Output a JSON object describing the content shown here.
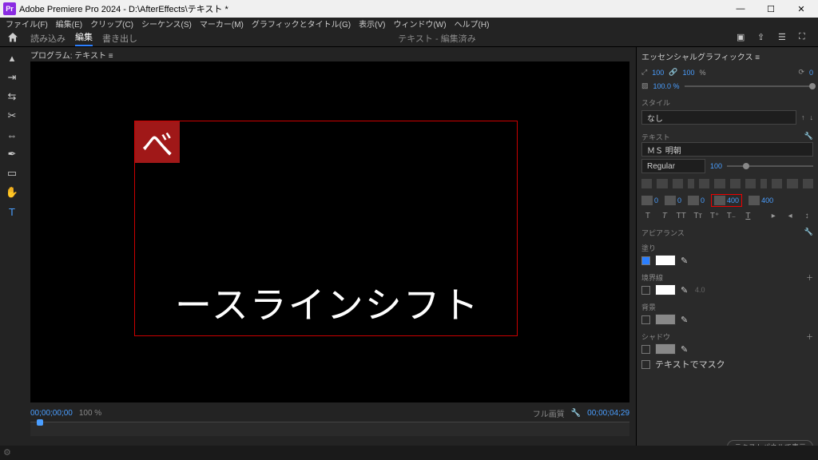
{
  "titlebar": {
    "app": "Adobe Premiere Pro 2024",
    "doc": "D:\\AfterEffects\\テキスト *"
  },
  "menu": [
    "ファイル(F)",
    "編集(E)",
    "クリップ(C)",
    "シーケンス(S)",
    "マーカー(M)",
    "グラフィックとタイトル(G)",
    "表示(V)",
    "ウィンドウ(W)",
    "ヘルプ(H)"
  ],
  "toptabs": {
    "items": [
      "読み込み",
      "編集",
      "書き出し"
    ],
    "center": "テキスト - 編集済み"
  },
  "program_label": "プログラム: テキスト ≡",
  "canvas": {
    "sel_char": "べ",
    "big_text": "ースラインシフト"
  },
  "viewer_footer": {
    "tc_left": "00;00;00;00",
    "pct": "100 %",
    "mode": "フル画質",
    "tc_right": "00;00;04;29"
  },
  "rp": {
    "title": "エッセンシャルグラフィックス ≡",
    "transform": {
      "scale_a": "100",
      "scale_b": "100",
      "pct": "%",
      "rot": "0",
      "opacity": "100.0 %"
    },
    "style_label": "スタイル",
    "style_value": "なし",
    "text_label": "テキスト",
    "font": "ＭＳ 明朝",
    "weight": "Regular",
    "size": "100",
    "metrics": {
      "va1": "0",
      "va2": "0",
      "baseline_a": "0",
      "baseline_b": "400",
      "tsume": "400"
    },
    "appearance_label": "アピアランス",
    "fill_label": "塗り",
    "stroke_label": "境界線",
    "stroke_val": "4.0",
    "bg_label": "背景",
    "shadow_label": "シャドウ",
    "mask_label": "テキストでマスク",
    "footer_btn": "テキストパネルで表示"
  }
}
